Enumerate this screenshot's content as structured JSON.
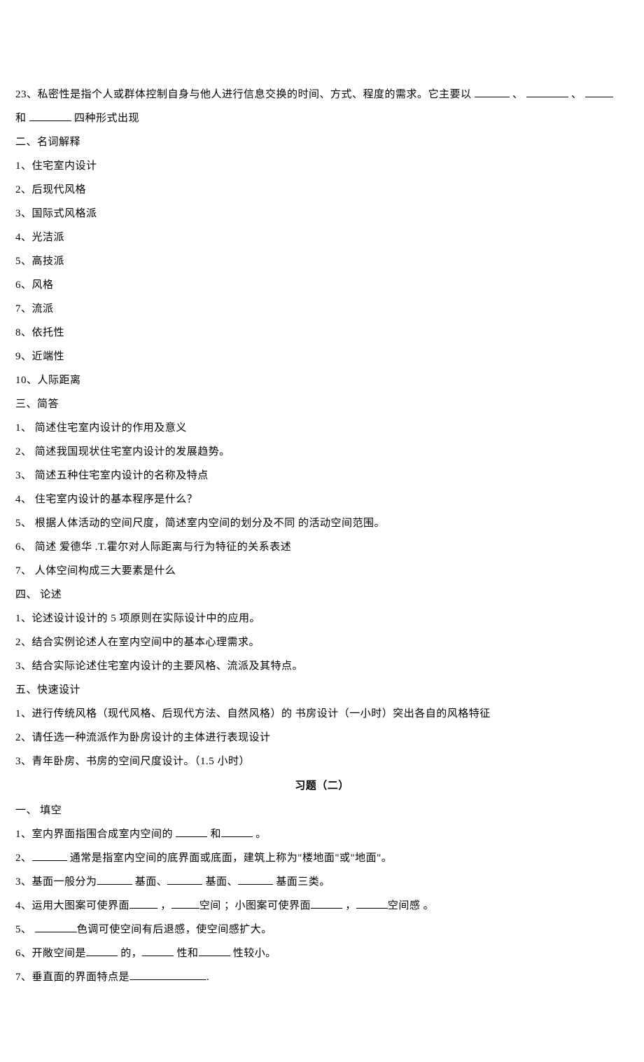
{
  "q23_pre": "23、私密性是指个人或群体控制自身与他人进行信息交换的时间、方式、程度的需求。它主要以",
  "sep_dot": "、",
  "q23_and": "和",
  "q23_post": "四种形式出现",
  "s2_title": "二、名词解释",
  "s2_items": [
    "1、住宅室内设计",
    "2、后现代风格",
    "3、国际式风格派",
    "4、光洁派",
    "5、高技派",
    "6、风格",
    "7、流派",
    "8、依托性",
    "9、近端性",
    "10、人际距离"
  ],
  "s3_title": "三、简答",
  "s3_items": [
    "1、 简述住宅室内设计的作用及意义",
    "2、 简述我国现状住宅室内设计的发展趋势。",
    "3、  简述五种住宅室内设计的名称及特点",
    "4、  住宅室内设计的基本程序是什么？",
    "5、 根据人体活动的空间尺度，简述室内空间的划分及不同 的活动空间范围。",
    "6、  简述 爱德华 .T.霍尔对人际距离与行为特征的关系表述",
    "7、  人体空间构成三大要素是什么"
  ],
  "s4_title": "四、 论述",
  "s4_items": [
    "1、论述设计设计的 5 项原则在实际设计中的应用。",
    "2、结合实例论述人在室内空间中的基本心理需求。",
    "3、结合实际论述住宅室内设计的主要风格、流派及其特点。"
  ],
  "s5_title": "五、快速设计",
  "s5_items": [
    "1、进行传统风格（现代风格、后现代方法、自然风格）的 书房设计（一小时）突出各自的风格特征",
    "2、请任选一种流派作为卧房设计的主体进行表现设计",
    "3、青年卧房、书房的空间尺度设计。（1.5 小时）"
  ],
  "title2": "习题（二）",
  "p2_s1": "一、 填空",
  "p2_q1_a": "1、室内界面指围合成室内空间的",
  "p2_q1_b": "和",
  "p2_q1_c": "。",
  "p2_q2_a": "2、",
  "p2_q2_b": "通常是指室内空间的底界面或底面，建筑上称为\"楼地面\"或\"地面\"。",
  "p2_q3_a": "3、基面一般分为",
  "p2_q3_b": "基面、",
  "p2_q3_c": "基面、",
  "p2_q3_d": "基面三类。",
  "p2_q4_a": "4、运用大图案可使界面",
  "p2_q4_b": "，",
  "p2_q4_c": "空间 ；小图案可使界面",
  "p2_q4_d": "，",
  "p2_q4_e": "空间感 。",
  "p2_q5_a": "5、",
  "p2_q5_b": "色调可使空间有后退感，使空间感扩大。",
  "p2_q6_a": "6、开敞空间是",
  "p2_q6_b": "的，",
  "p2_q6_c": "性和",
  "p2_q6_d": "性较小。",
  "p2_q7_a": "7、垂直面的界面特点是",
  "p2_q7_b": "."
}
